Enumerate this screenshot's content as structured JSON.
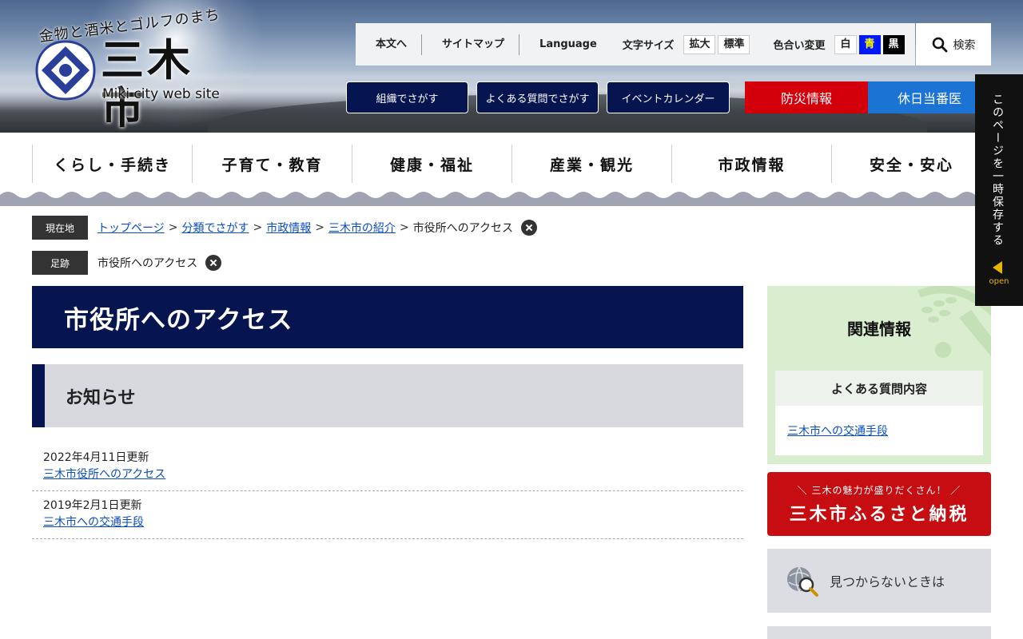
{
  "header": {
    "tagline": "金物と酒米とゴルフのまち",
    "city_name": "三木市",
    "city_en": "Miki city web site",
    "utility": {
      "skip": "本文へ",
      "sitemap": "サイトマップ",
      "language": "Language",
      "font_size_label": "文字サイズ",
      "font_large": "拡大",
      "font_normal": "標準",
      "color_label": "色合い変更",
      "color_white": "白",
      "color_blue": "青",
      "color_black": "黒",
      "search": "検索"
    },
    "buttons": {
      "org": "組織でさがす",
      "faq": "よくある質問でさがす",
      "events": "イベントカレンダー",
      "disaster": "防災情報",
      "holiday": "休日当番医"
    }
  },
  "gnav": [
    "くらし・手続き",
    "子育て・教育",
    "健康・福祉",
    "産業・観光",
    "市政情報",
    "安全・安心"
  ],
  "breadcrumb": {
    "label": "現在地",
    "items": [
      "トップページ",
      "分類でさがす",
      "市政情報",
      "三木市の紹介"
    ],
    "current": "市役所へのアクセス"
  },
  "history": {
    "label": "足跡",
    "item": "市役所へのアクセス"
  },
  "main": {
    "title": "市役所へのアクセス",
    "section": "お知らせ",
    "news": [
      {
        "date": "2022年4月11日更新",
        "title": "三木市役所へのアクセス"
      },
      {
        "date": "2019年2月1日更新",
        "title": "三木市への交通手段"
      }
    ]
  },
  "sidebar": {
    "related_title": "関連情報",
    "faq_head": "よくある質問内容",
    "faq_link": "三木市への交通手段",
    "furusato_sub": "＼ 三木の魅力が盛りだくさん！ ／",
    "furusato_main": "三木市ふるさと納税",
    "notfound": "見つからないときは"
  },
  "float": {
    "text": "このページを一時保存する",
    "open": "open"
  },
  "colors": {
    "navy": "#061450",
    "disaster_red": "#d3000b",
    "holiday_blue": "#1b73d4",
    "side_green": "#d9edcf",
    "link": "#0a4cc2"
  }
}
